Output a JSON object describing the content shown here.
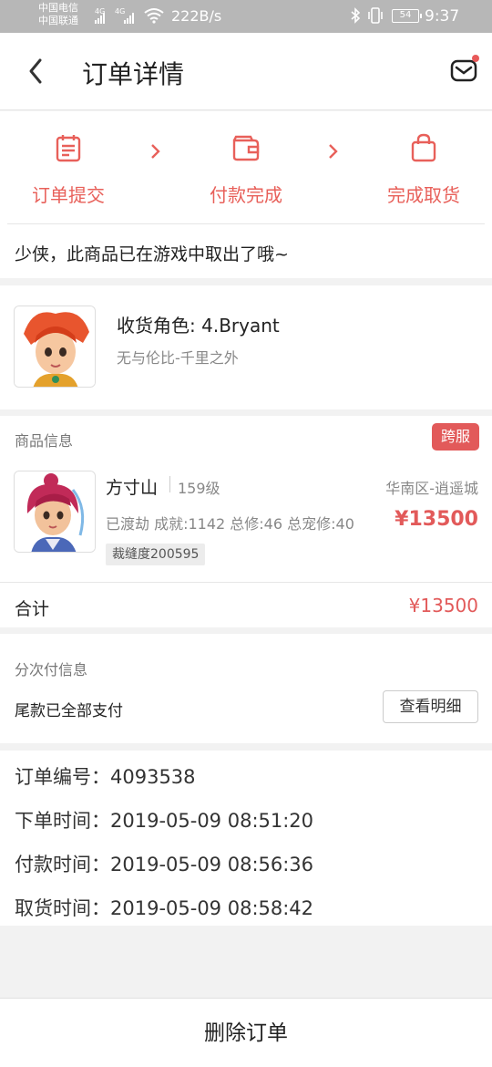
{
  "status_bar": {
    "carrier1": "中国电信",
    "carrier2": "中国联通",
    "net1": "4G",
    "net2": "4G",
    "speed": "222B/s",
    "battery": "54",
    "time": "9:37"
  },
  "header": {
    "title": "订单详情",
    "back_icon": "chevron-left-icon",
    "mail_icon": "mail-icon"
  },
  "progress": {
    "steps": [
      {
        "label": "订单提交",
        "icon": "calendar-icon"
      },
      {
        "label": "付款完成",
        "icon": "wallet-icon"
      },
      {
        "label": "完成取货",
        "icon": "bag-icon"
      }
    ],
    "accent_color": "#e8605a"
  },
  "notice": "少侠，此商品已在游戏中取出了哦~",
  "receiver": {
    "label": "收货角色:",
    "name": "4.Bryant",
    "server": "无与伦比-千里之外"
  },
  "goods": {
    "header": "商品信息",
    "badge": "跨服",
    "name": "方寸山",
    "level": "159级",
    "region": "华南区-逍遥城",
    "stats": "已渡劫 成就:1142 总修:46 总宠修:40",
    "price": "¥13500",
    "tag": "裁缝度200595",
    "total_label": "合计",
    "total_value": "¥13500"
  },
  "installment": {
    "header": "分次付信息",
    "status": "尾款已全部支付",
    "button": "查看明细"
  },
  "order_info": {
    "rows": [
      {
        "label": "订单编号：",
        "value": "4093538"
      },
      {
        "label": "下单时间：",
        "value": "2019-05-09 08:51:20"
      },
      {
        "label": "付款时间：",
        "value": "2019-05-09 08:56:36"
      },
      {
        "label": "取货时间：",
        "value": "2019-05-09 08:58:42"
      }
    ]
  },
  "bottom": {
    "delete_label": "删除订单"
  }
}
